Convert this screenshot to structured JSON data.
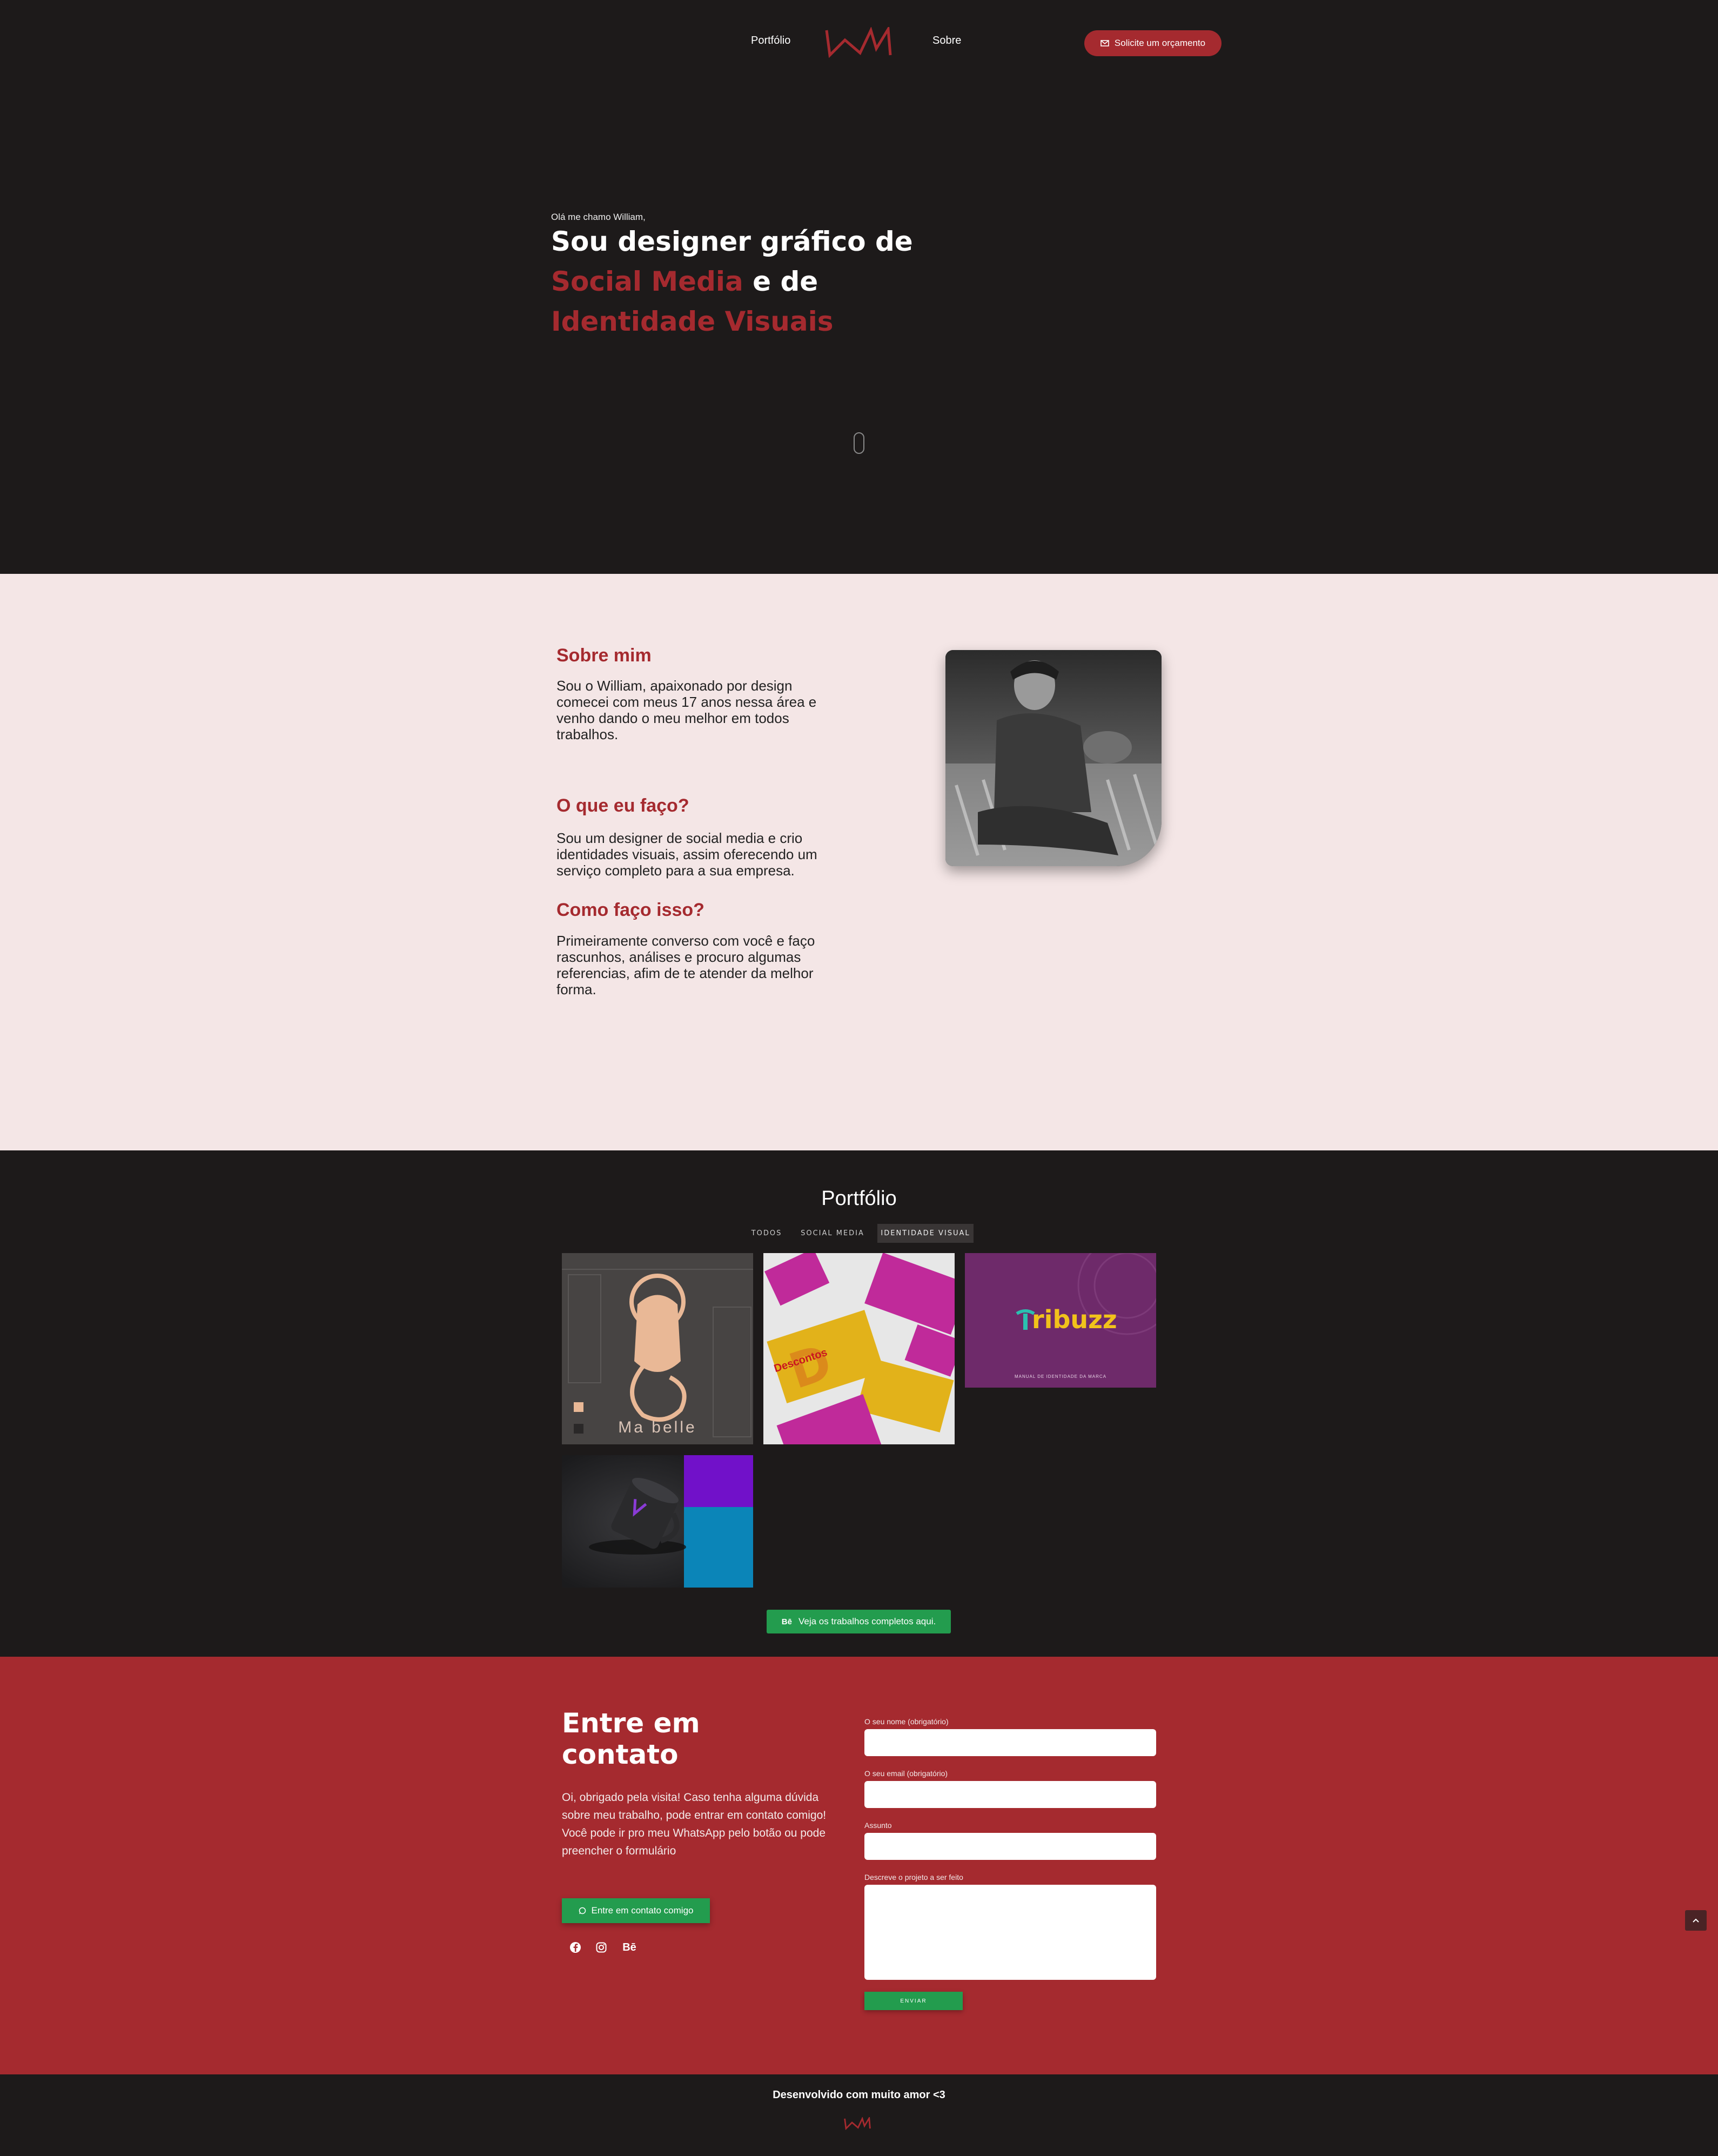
{
  "nav": {
    "portfolio_label": "Portfólio",
    "about_label": "Sobre",
    "cta_label": "Solicite um orçamento",
    "logo_icon": "wm-logo-icon",
    "cta_icon": "envelope-icon"
  },
  "hero": {
    "greeting": "Olá me chamo William,",
    "line1": "Sou designer gráfico de",
    "line2_accent": "Social Media",
    "line2_rest": " e de",
    "line3_accent": "Identidade Visuais",
    "scroll_icon": "mouse-scroll-icon"
  },
  "about": {
    "h1": "Sobre mim",
    "p1": "Sou o William, apaixonado por design comecei com meus 17 anos nessa área e venho dando o meu melhor em todos trabalhos.",
    "h2": "O que eu faço?",
    "p2": "Sou um designer de social media e crio identidades visuais, assim oferecendo um serviço completo para a sua empresa.",
    "h3": "Como faço isso?",
    "p3": "Primeiramente converso com você e faço rascunhos, análises e procuro algumas referencias, afim de te atender da melhor forma."
  },
  "portfolio": {
    "title": "Portfólio",
    "filters": [
      "TODOS",
      "SOCIAL MEDIA",
      "IDENTIDADE VISUAL"
    ],
    "active_filter": "IDENTIDADE VISUAL",
    "tiles": {
      "mabelle_text": "Ma belle",
      "descontos_text": "Descontos",
      "tribuzz_text": "ribuzz",
      "tribuzz_sub": "MANUAL DE IDENTIDADE DA MARCA"
    },
    "behance_button": "Veja os trabalhos completos aqui.",
    "behance_icon": "behance-icon"
  },
  "contact": {
    "title": "Entre em contato",
    "text": "Oi, obrigado pela visita! Caso tenha alguma dúvida sobre meu trabalho, pode entrar em contato comigo! Você pode ir pro meu WhatsApp pelo botão ou pode preencher o formulário",
    "whatsapp_button": "Entre em contato comigo",
    "socials": [
      "facebook-icon",
      "instagram-icon",
      "behance-icon"
    ],
    "behance_glyph": "Bē",
    "form": {
      "name_label": "O seu nome (obrigatório)",
      "email_label": "O seu email (obrigatório)",
      "subject_label": "Assunto",
      "message_label": "Descreve o projeto a ser feito",
      "send_label": "ENVIAR"
    }
  },
  "footer": {
    "text": "Desenvolvido com muito amor <3"
  },
  "colors": {
    "background_dark": "#1d1a1a",
    "accent_red": "#a52a2f",
    "about_bg": "#f4e6e6",
    "green": "#239c4e"
  }
}
